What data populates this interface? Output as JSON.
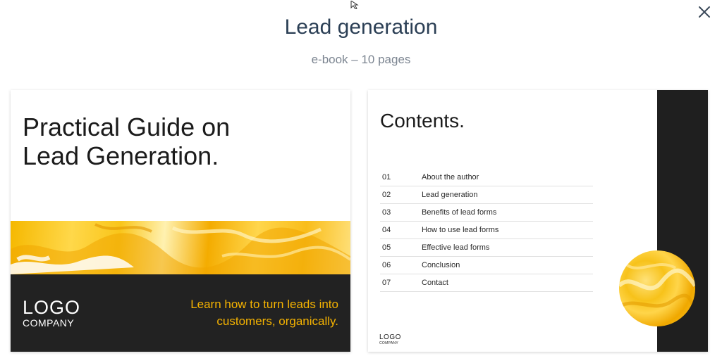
{
  "header": {
    "title": "Lead generation",
    "subtitle": "e-book – 10 pages"
  },
  "cover_page": {
    "heading_line1": "Practical Guide on",
    "heading_line2": "Lead Generation.",
    "logo_line1": "LOGO",
    "logo_line2": "COMPANY",
    "tagline_line1": "Learn how to turn leads into",
    "tagline_line2": "customers, organically.",
    "accent_color": "#f5b301"
  },
  "contents_page": {
    "title": "Contents.",
    "items": [
      {
        "num": "01",
        "label": "About the author"
      },
      {
        "num": "02",
        "label": "Lead generation"
      },
      {
        "num": "03",
        "label": "Benefits of lead forms"
      },
      {
        "num": "04",
        "label": "How to use lead forms"
      },
      {
        "num": "05",
        "label": "Effective lead forms"
      },
      {
        "num": "06",
        "label": "Conclusion"
      },
      {
        "num": "07",
        "label": "Contact"
      }
    ],
    "logo_line1": "LOGO",
    "logo_line2": "COMPANY"
  },
  "icons": {
    "close": "close-icon",
    "cursor": "cursor-icon"
  }
}
